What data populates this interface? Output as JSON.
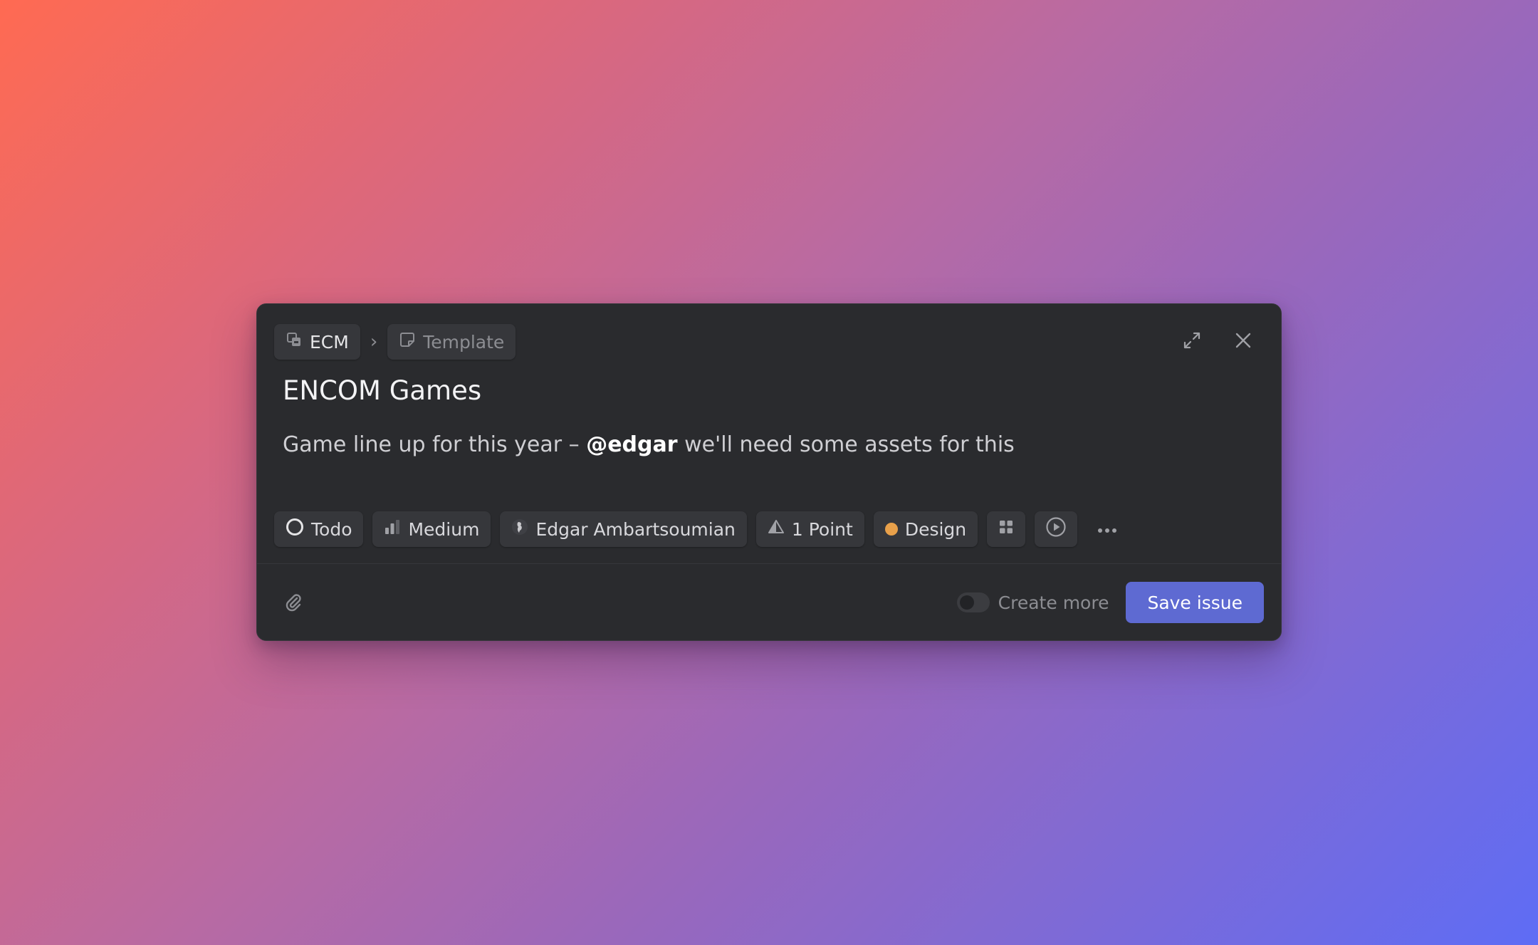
{
  "breadcrumb": {
    "team": "ECM",
    "separator": "›",
    "template": "Template"
  },
  "issue": {
    "title": "ENCOM Games",
    "description_before": "Game line up for this year – ",
    "mention": "@edgar",
    "description_after": " we'll need some assets for this"
  },
  "properties": {
    "status": "Todo",
    "priority": "Medium",
    "assignee": "Edgar Ambartsoumian",
    "estimate": "1 Point",
    "label": "Design",
    "label_color": "#e8a04a"
  },
  "footer": {
    "create_more_label": "Create more",
    "create_more_enabled": false,
    "save_label": "Save issue"
  },
  "colors": {
    "modal_bg": "#2a2b2e",
    "accent": "#5e6ad2"
  },
  "icons": {
    "team": "team-icon",
    "template": "template-icon",
    "expand": "expand-icon",
    "close": "close-icon",
    "status": "circle-status-icon",
    "priority": "bar-chart-icon",
    "assignee": "avatar",
    "estimate": "triangle-icon",
    "project": "grid-icon",
    "cycle": "play-circle-icon",
    "more": "more-icon",
    "attach": "paperclip-icon"
  }
}
